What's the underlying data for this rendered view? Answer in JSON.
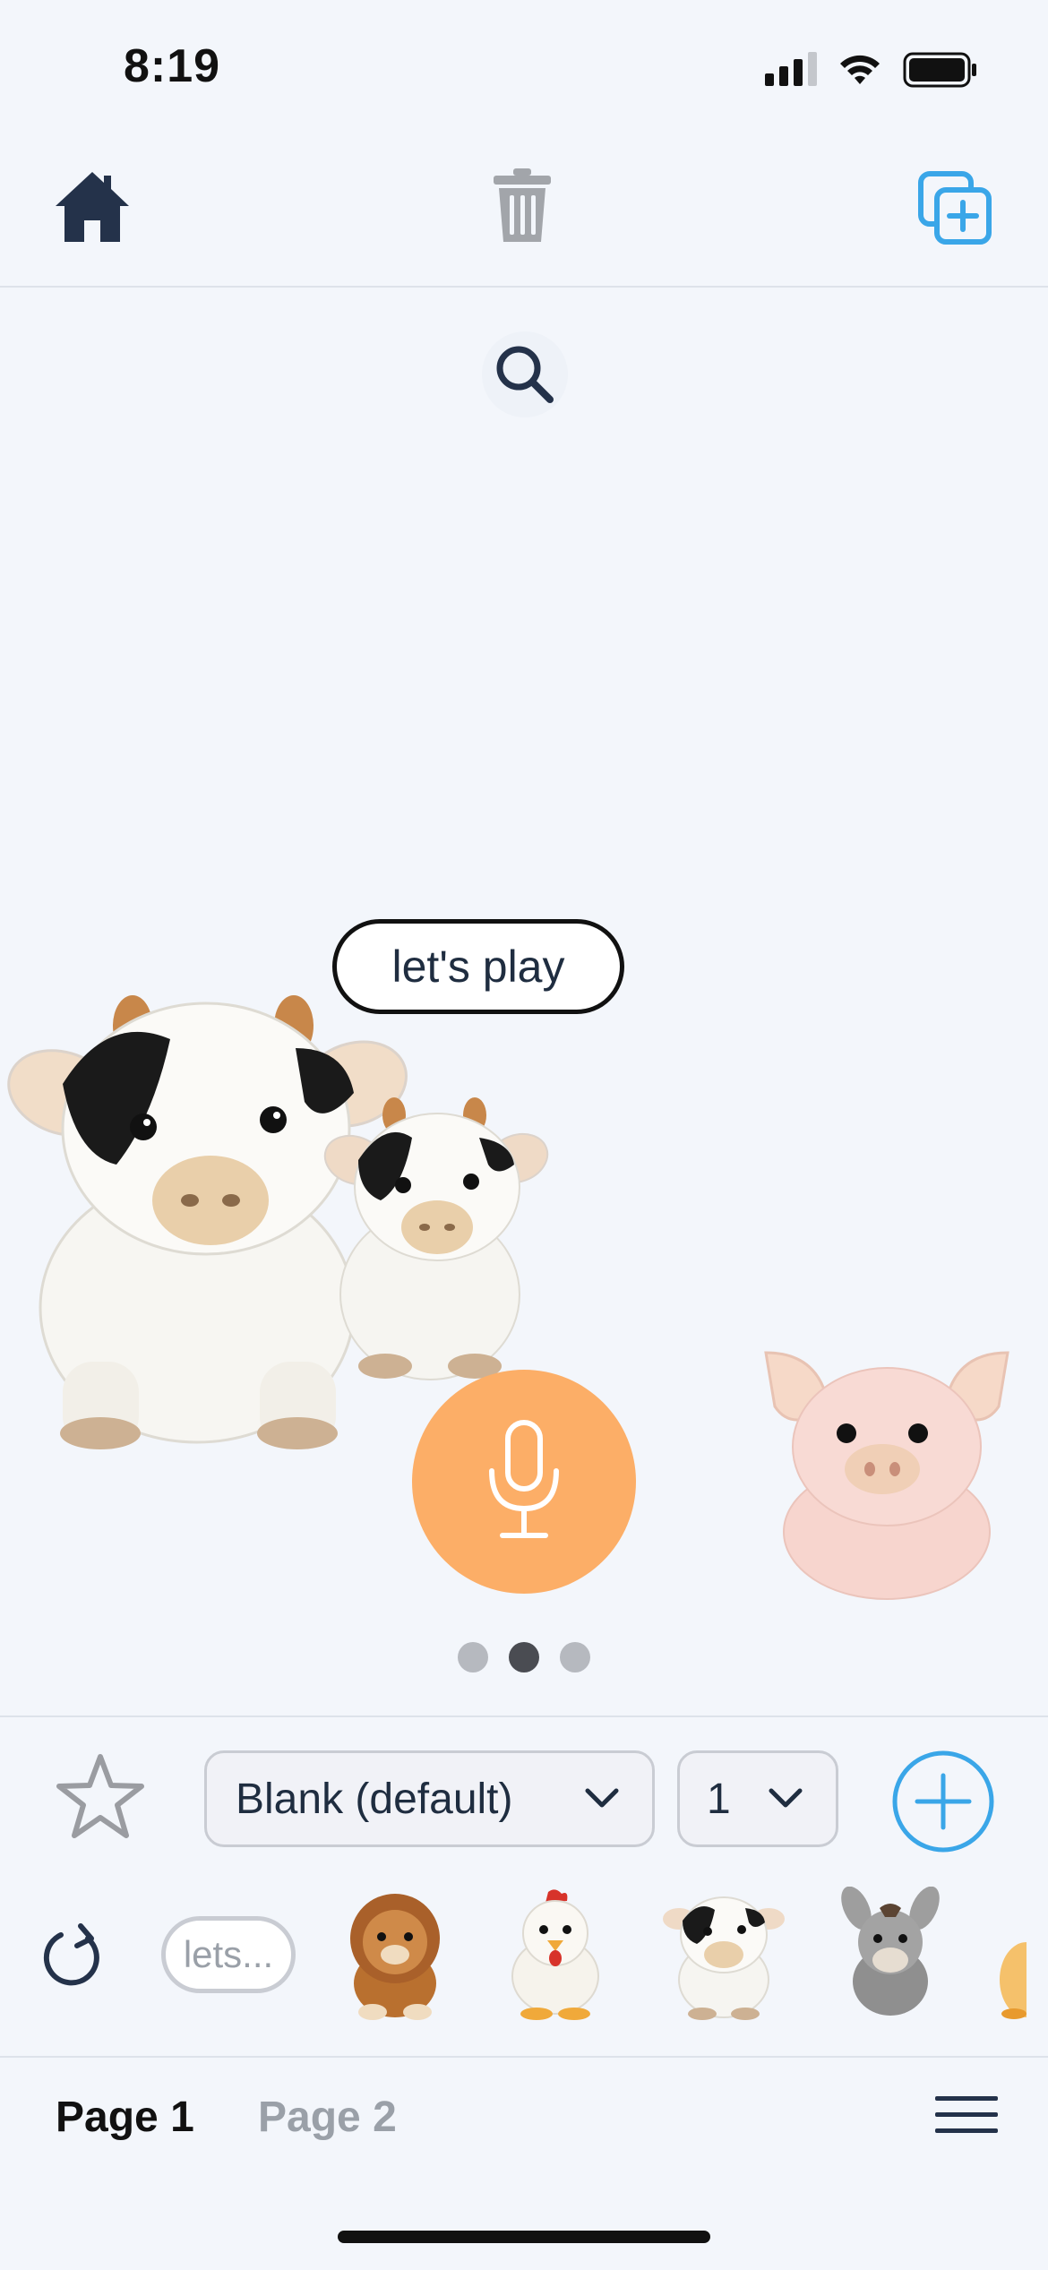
{
  "status_bar": {
    "time": "8:19"
  },
  "toolbar": {
    "home_icon": "home-icon",
    "trash_icon": "trash-icon",
    "add_copy_icon": "add-copy-icon",
    "accent_color": "#3aa6e8"
  },
  "canvas": {
    "speech_bubble": "let's play",
    "characters": [
      "cow plush (large)",
      "cow plush (small)",
      "pig plush"
    ],
    "page_dots": {
      "count": 3,
      "active_index": 1
    }
  },
  "controls": {
    "voice_select": {
      "value": "Blank (default)"
    },
    "count_select": {
      "value": "1"
    },
    "phrase_chip": "lets...",
    "tray_items": [
      "lion plush",
      "chicken plush",
      "cow plush",
      "donkey plush",
      "duck plush"
    ]
  },
  "tabs": {
    "page1": "Page 1",
    "page2": "Page 2"
  },
  "colors": {
    "mic": "#fcae67",
    "accent": "#3aa6e8",
    "background": "#f3f6fb"
  }
}
